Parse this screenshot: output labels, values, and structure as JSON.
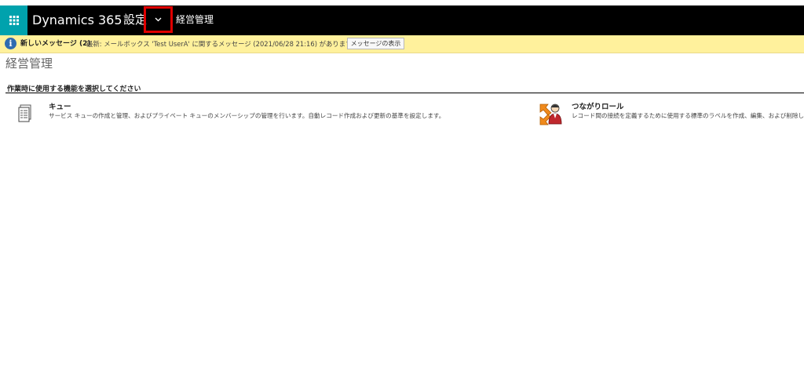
{
  "topnav": {
    "brand": "Dynamics 365",
    "area": "設定",
    "breadcrumb": "経営管理",
    "colors": {
      "bar": "#000000",
      "waffle": "#00a2ad",
      "highlight": "#e00000"
    }
  },
  "notification": {
    "title": "新しいメッセージ (2)",
    "message": "最新: メールボックス 'Test UserA' に関するメッセージ (2021/06/28 21:16) があります。",
    "button": "メッセージの表示",
    "color": "#fff19c"
  },
  "page": {
    "title": "経営管理",
    "section": "作業時に使用する機能を選択してください",
    "items": [
      {
        "name": "キュー",
        "description": "サービス キューの作成と管理、およびプライベート キューのメンバーシップの管理を行います。自動レコード作成および更新の基準を設定します。",
        "icon": "queue-icon"
      },
      {
        "name": "つながりロール",
        "description": "レコード間の接続を定義するために使用する標準のラベルを作成、編集、および削除します。",
        "icon": "connection-role-icon"
      }
    ]
  }
}
